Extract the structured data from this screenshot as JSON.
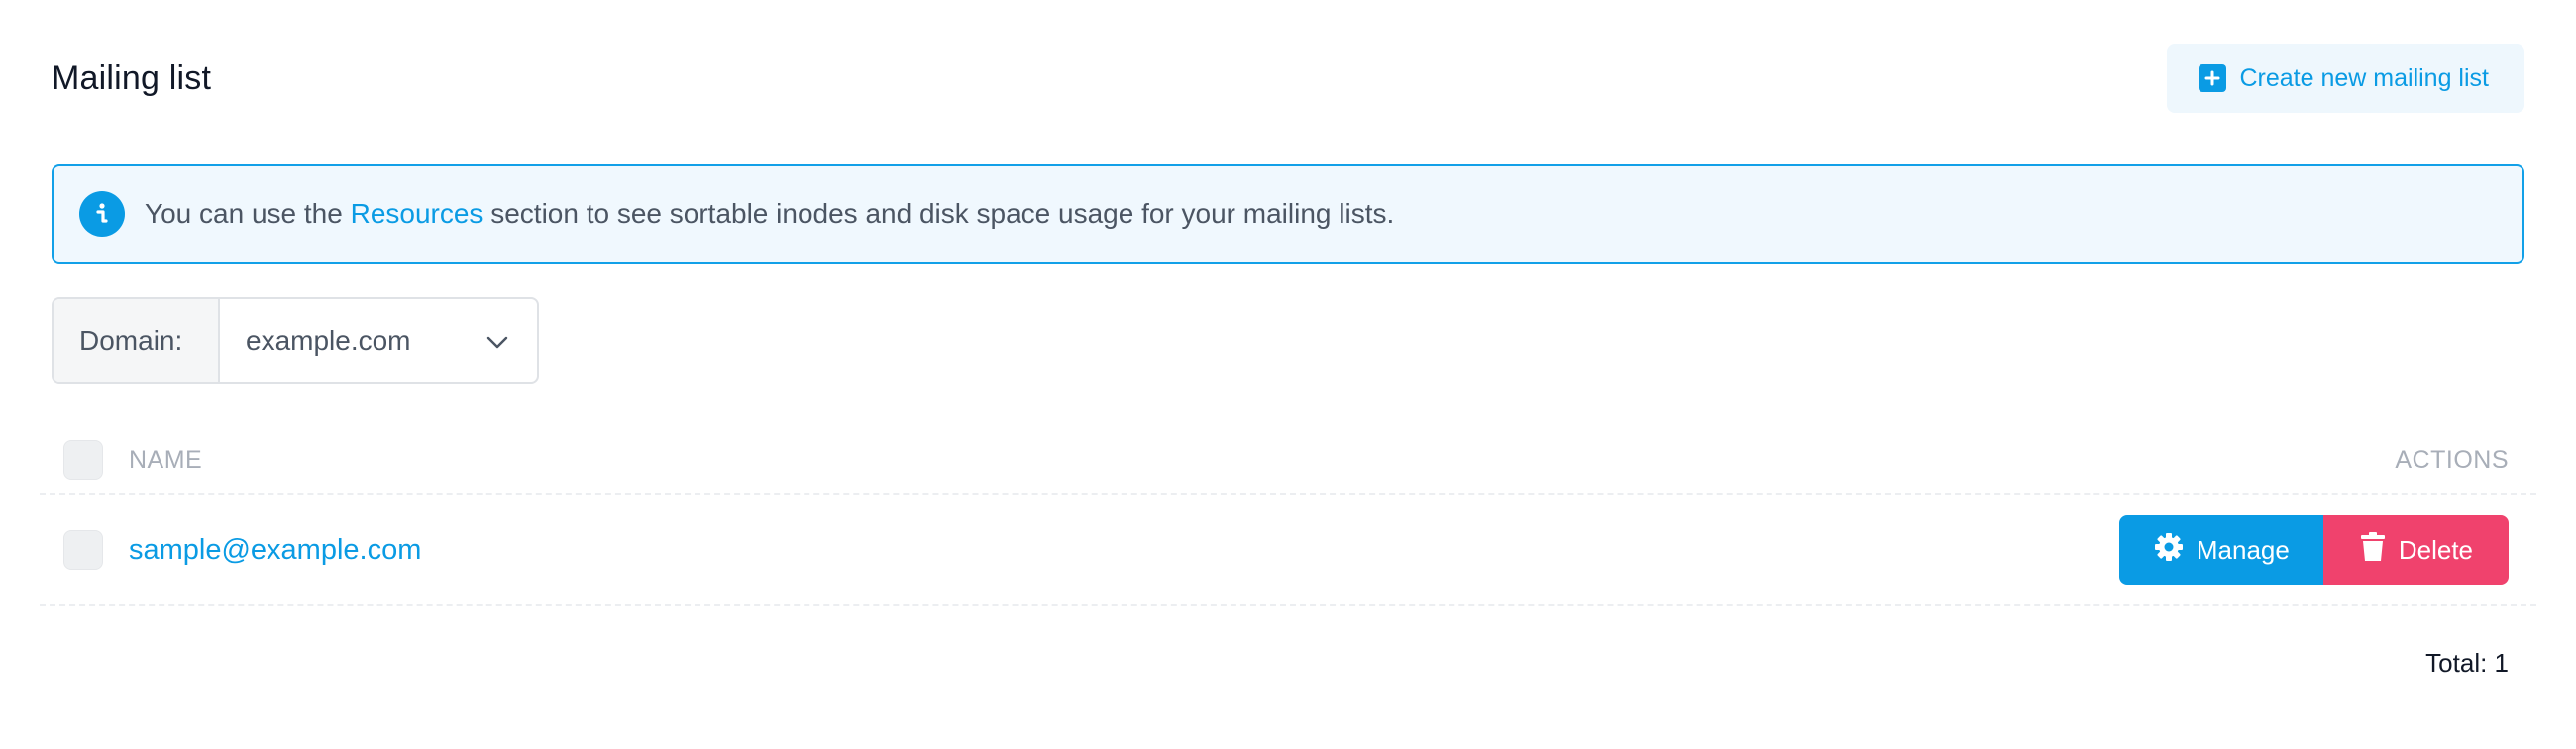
{
  "header": {
    "title": "Mailing list",
    "create_button_label": "Create new mailing list"
  },
  "info": {
    "text_before": "You can use the ",
    "link_text": "Resources",
    "text_after": " section to see sortable inodes and disk space usage for your mailing lists."
  },
  "domain_selector": {
    "label": "Domain:",
    "selected": "example.com"
  },
  "table": {
    "columns": {
      "name": "NAME",
      "actions": "ACTIONS"
    },
    "rows": [
      {
        "name": "sample@example.com",
        "manage_label": "Manage",
        "delete_label": "Delete"
      }
    ],
    "total_label": "Total: 1"
  },
  "icons": {
    "create": "plus-square-icon",
    "info": "info-circle-icon",
    "dropdown": "chevron-down-icon",
    "manage": "gear-icon",
    "delete": "trash-icon"
  },
  "colors": {
    "accent": "#0a9be4",
    "danger": "#f0426d",
    "info_bg": "#f0f8fe"
  }
}
